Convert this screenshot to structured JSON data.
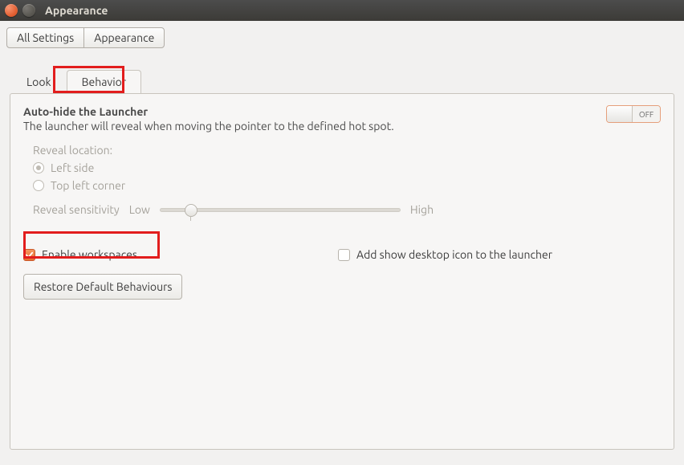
{
  "window": {
    "title": "Appearance"
  },
  "breadcrumb": {
    "all_settings": "All Settings",
    "current": "Appearance"
  },
  "tabs": {
    "look": "Look",
    "behavior": "Behavior"
  },
  "autohide": {
    "title": "Auto-hide the Launcher",
    "subtitle": "The launcher will reveal when moving the pointer to the defined hot spot.",
    "switch_state": "OFF"
  },
  "reveal": {
    "heading": "Reveal location:",
    "left_side": "Left side",
    "top_left": "Top left corner",
    "sensitivity_label": "Reveal sensitivity",
    "low": "Low",
    "high": "High"
  },
  "checks": {
    "enable_workspaces": "Enable workspaces",
    "show_desktop_icon": "Add show desktop icon to the launcher"
  },
  "buttons": {
    "restore": "Restore Default Behaviours"
  }
}
